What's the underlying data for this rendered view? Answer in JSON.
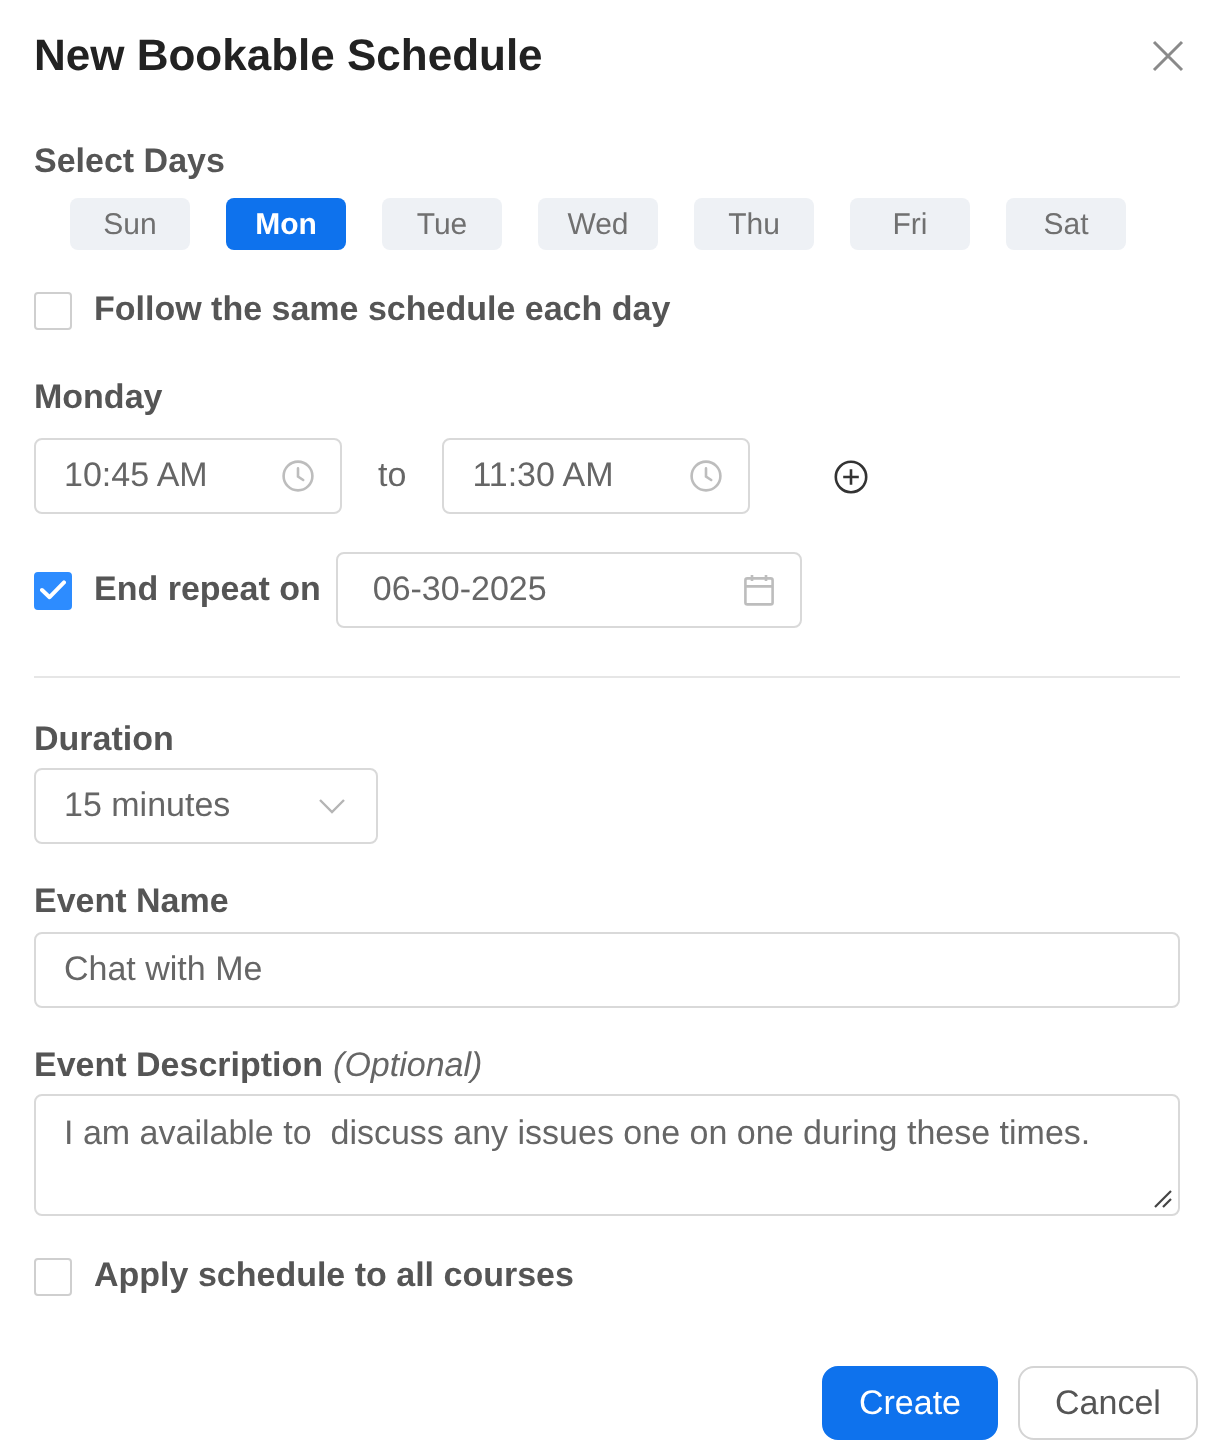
{
  "dialog": {
    "title": "New Bookable Schedule"
  },
  "select_days": {
    "label": "Select Days",
    "days": [
      {
        "label": "Sun",
        "selected": false
      },
      {
        "label": "Mon",
        "selected": true
      },
      {
        "label": "Tue",
        "selected": false
      },
      {
        "label": "Wed",
        "selected": false
      },
      {
        "label": "Thu",
        "selected": false
      },
      {
        "label": "Fri",
        "selected": false
      },
      {
        "label": "Sat",
        "selected": false
      }
    ]
  },
  "follow_same": {
    "label": "Follow the same schedule each day",
    "checked": false
  },
  "day_schedule": {
    "label": "Monday",
    "start_time": "10:45 AM",
    "separator": "to",
    "end_time": "11:30 AM"
  },
  "end_repeat": {
    "label": "End repeat on",
    "checked": true,
    "date": "06-30-2025"
  },
  "duration": {
    "label": "Duration",
    "value": "15 minutes"
  },
  "event_name": {
    "label": "Event Name",
    "value": "Chat with Me"
  },
  "event_description": {
    "label": "Event Description",
    "hint": "(Optional)",
    "value": "I am available to  discuss any issues one on one during these times."
  },
  "apply_all": {
    "label": "Apply schedule to all courses",
    "checked": false
  },
  "buttons": [
    {
      "label": "Create",
      "kind": "primary"
    },
    {
      "label": "Cancel",
      "kind": "secondary"
    }
  ]
}
